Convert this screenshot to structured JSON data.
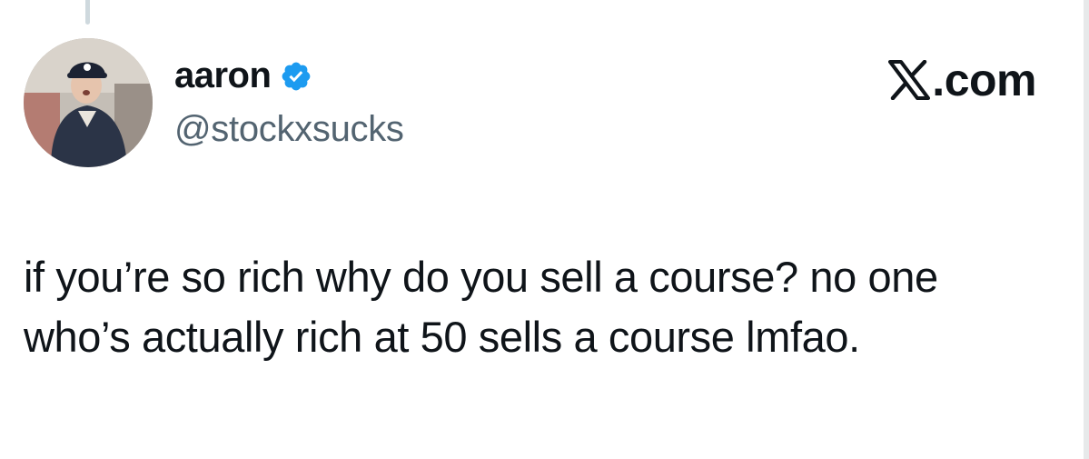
{
  "author": {
    "display_name": "aaron",
    "handle": "@stockxsucks",
    "verified": true,
    "verified_color": "#1d9bf0"
  },
  "brand": {
    "logo_icon": "x-logo-icon",
    "text": ".com"
  },
  "tweet": {
    "text": "if you’re so rich why do you sell a course? no one who’s actually rich at 50 sells a course lmfao."
  },
  "colors": {
    "text_primary": "#0f1419",
    "text_secondary": "#536471",
    "background": "#ffffff"
  }
}
